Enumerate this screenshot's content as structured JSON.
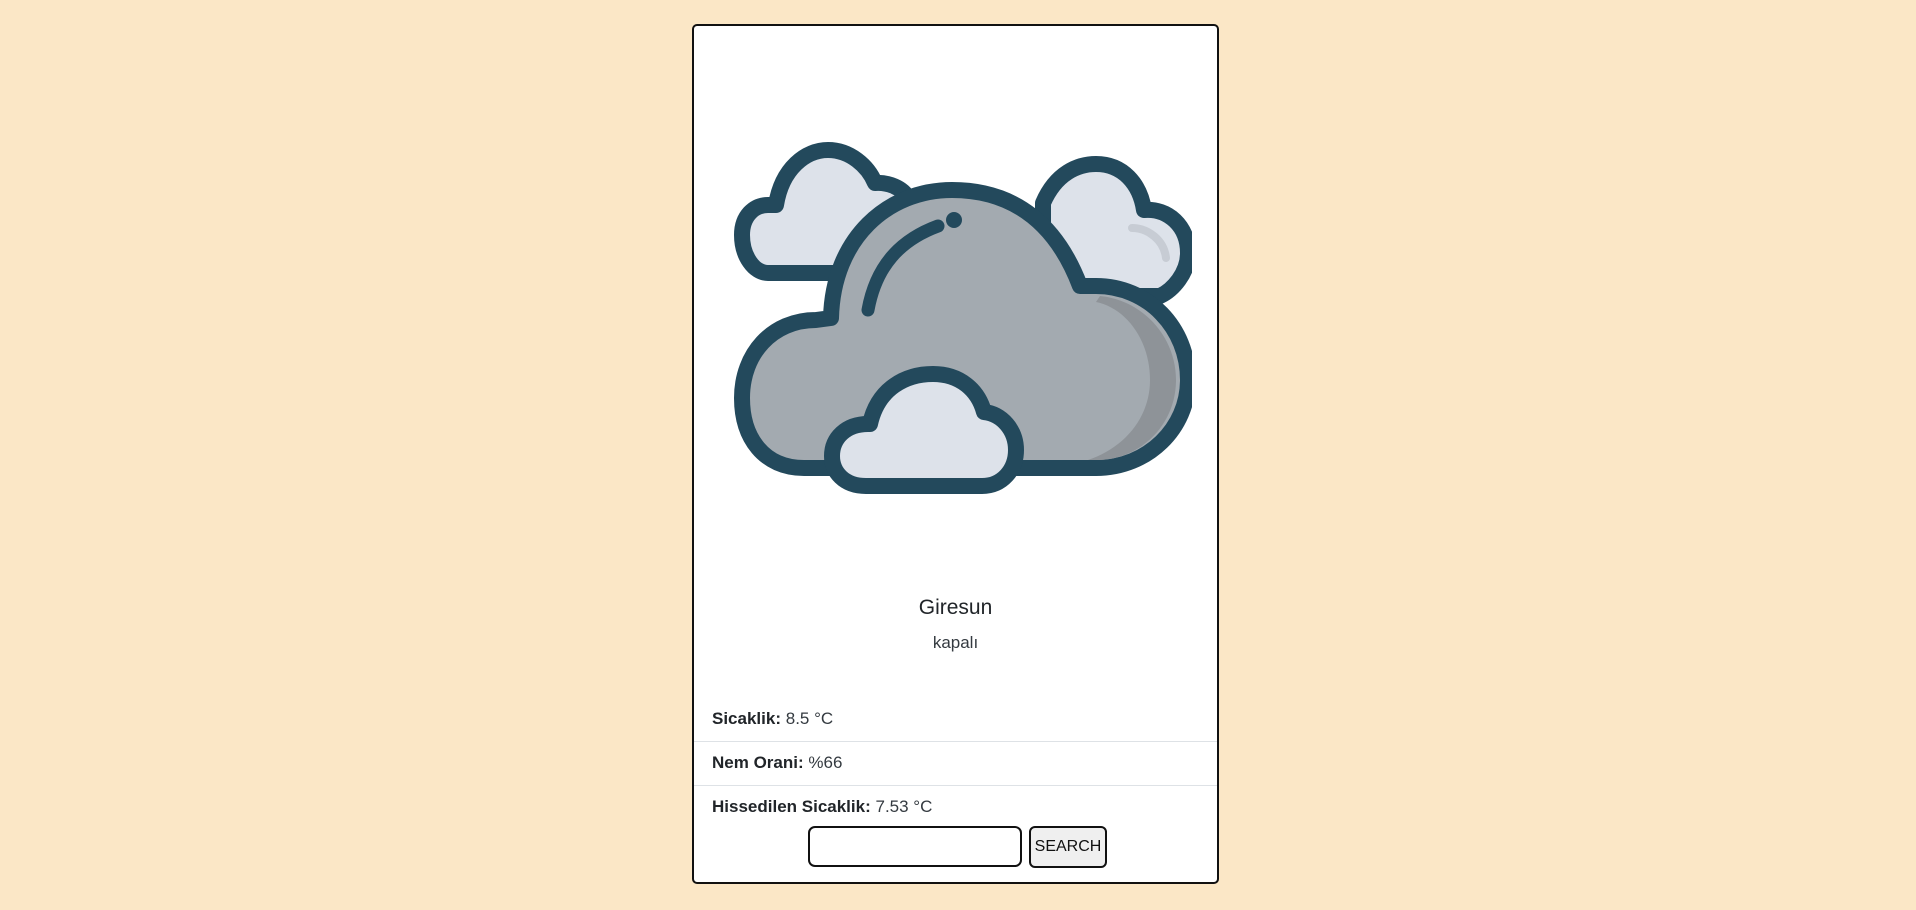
{
  "weather": {
    "icon": "overcast-clouds-icon",
    "city": "Giresun",
    "description": "kapalı"
  },
  "details": [
    {
      "label": "Sicaklik:",
      "value": "8.5 °C"
    },
    {
      "label": "Nem Orani:",
      "value": "%66"
    },
    {
      "label": "Hissedilen Sicaklik:",
      "value": "7.53 °C"
    }
  ],
  "search": {
    "value": "",
    "placeholder": "",
    "button_label": "SEARCH"
  },
  "colors": {
    "background": "#fbe7c6",
    "card": "#ffffff",
    "outline": "#23495c",
    "cloud_gray": "#a3aab0",
    "cloud_light": "#dde2ea"
  }
}
